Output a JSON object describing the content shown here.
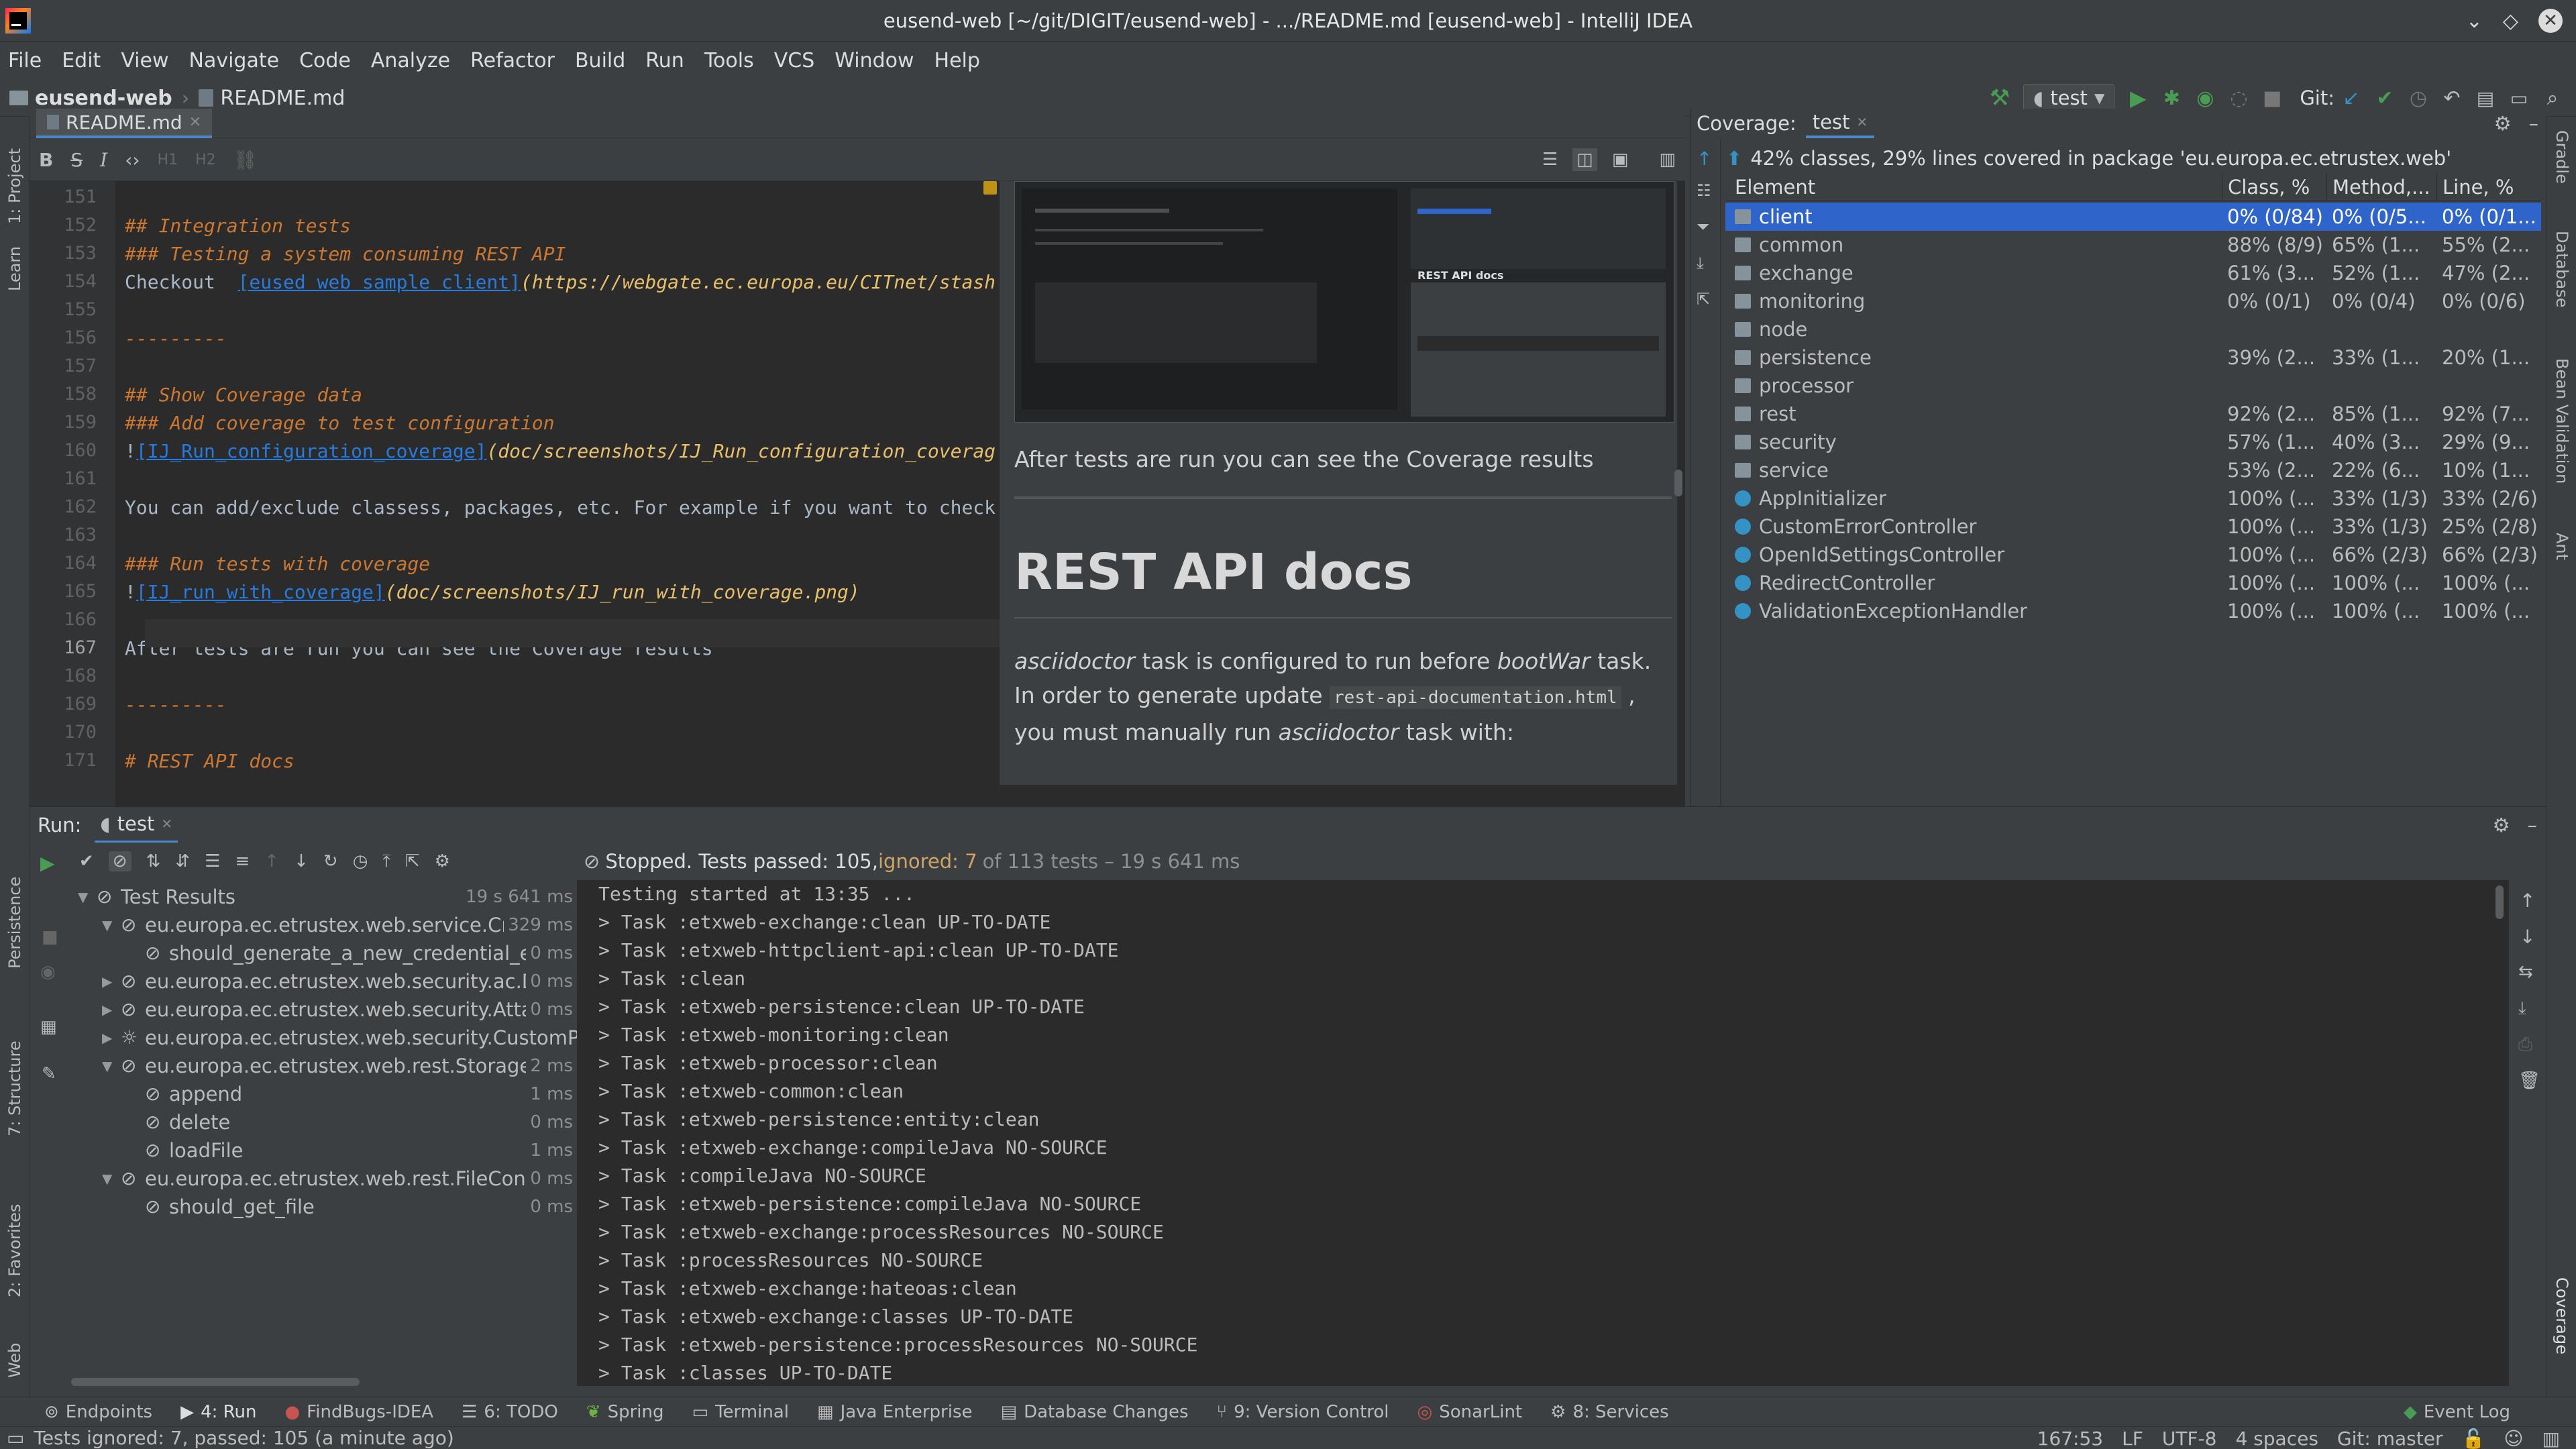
{
  "window": {
    "title": "eusend-web [~/git/DIGIT/eusend-web] - .../README.md [eusend-web] - IntelliJ IDEA"
  },
  "menu": [
    "File",
    "Edit",
    "View",
    "Navigate",
    "Code",
    "Analyze",
    "Refactor",
    "Build",
    "Run",
    "Tools",
    "VCS",
    "Window",
    "Help"
  ],
  "nav": {
    "project": "eusend-web",
    "file": "README.md",
    "run_config": "test",
    "git_label": "Git:"
  },
  "left_tools": [
    "1: Project",
    "Learn"
  ],
  "editor": {
    "tab": "README.md",
    "lines": [
      {
        "n": "151",
        "t": ""
      },
      {
        "n": "152",
        "t": "## Integration tests",
        "k": "h"
      },
      {
        "n": "153",
        "t": "### Testing a system consuming REST API",
        "k": "h"
      },
      {
        "n": "154",
        "pre": "Checkout  ",
        "link": "[eused web sample client]",
        "url": "(https://webgate.ec.europa.eu/CITnet/stash"
      },
      {
        "n": "155",
        "t": ""
      },
      {
        "n": "156",
        "t": "---------",
        "k": "h"
      },
      {
        "n": "157",
        "t": ""
      },
      {
        "n": "158",
        "t": "## Show Coverage data",
        "k": "h"
      },
      {
        "n": "159",
        "t": "### Add coverage to test configuration",
        "k": "h"
      },
      {
        "n": "160",
        "pre": "!",
        "link": "[IJ_Run_configuration_coverage]",
        "url": "(doc/screenshots/IJ_Run_configuration_coverag"
      },
      {
        "n": "161",
        "t": ""
      },
      {
        "n": "162",
        "t": "You can add/exclude classess, packages, etc. For example if you want to check"
      },
      {
        "n": "163",
        "t": ""
      },
      {
        "n": "164",
        "t": "### Run tests with coverage",
        "k": "h"
      },
      {
        "n": "165",
        "pre": "!",
        "link": "[IJ_run_with_coverage]",
        "url": "(doc/screenshots/IJ_run_with_coverage.png)"
      },
      {
        "n": "166",
        "t": ""
      },
      {
        "n": "167",
        "t": "After tests are run you can see the Coverage results"
      },
      {
        "n": "168",
        "t": ""
      },
      {
        "n": "169",
        "t": "---------",
        "k": "h"
      },
      {
        "n": "170",
        "t": ""
      },
      {
        "n": "171",
        "t": "# REST API docs",
        "k": "h"
      }
    ]
  },
  "preview": {
    "caption": "After tests are run you can see the Coverage results",
    "heading": "REST API docs",
    "para_em1": "asciidoctor",
    "para_t1": " task is configured to run before ",
    "para_em2": "bootWar",
    "para_t2": " task.",
    "para_t3": "In order to generate update ",
    "para_code": "rest-api-documentation.html",
    "para_t4": " ,",
    "para_t5": "you must manually run ",
    "para_em3": "asciidoctor",
    "para_t6": " task with:",
    "thumb_title": "REST API docs"
  },
  "coverage": {
    "label": "Coverage:",
    "tab": "test",
    "summary": "42% classes, 29% lines covered in package 'eu.europa.ec.etrustex.web'",
    "columns": [
      "Element",
      "Class, %",
      "Method,...",
      "Line, %"
    ],
    "rows": [
      {
        "name": "client",
        "kind": "pkg",
        "c": "0% (0/84)",
        "m": "0% (0/5...",
        "l": "0% (0/1..."
      },
      {
        "name": "common",
        "kind": "pkg",
        "c": "88% (8/9)",
        "m": "65% (1...",
        "l": "55% (2..."
      },
      {
        "name": "exchange",
        "kind": "pkg",
        "c": "61% (3...",
        "m": "52% (1...",
        "l": "47% (2..."
      },
      {
        "name": "monitoring",
        "kind": "pkg",
        "c": "0% (0/1)",
        "m": "0% (0/4)",
        "l": "0% (0/6)"
      },
      {
        "name": "node",
        "kind": "pkg",
        "c": "",
        "m": "",
        "l": ""
      },
      {
        "name": "persistence",
        "kind": "pkg",
        "c": "39% (2...",
        "m": "33% (1...",
        "l": "20% (1..."
      },
      {
        "name": "processor",
        "kind": "pkg",
        "c": "",
        "m": "",
        "l": ""
      },
      {
        "name": "rest",
        "kind": "pkg",
        "c": "92% (2...",
        "m": "85% (1...",
        "l": "92% (7..."
      },
      {
        "name": "security",
        "kind": "pkg",
        "c": "57% (1...",
        "m": "40% (3...",
        "l": "29% (9..."
      },
      {
        "name": "service",
        "kind": "pkg",
        "c": "53% (2...",
        "m": "22% (6...",
        "l": "10% (1..."
      },
      {
        "name": "AppInitializer",
        "kind": "cls",
        "c": "100% (...",
        "m": "33% (1/3)",
        "l": "33% (2/6)"
      },
      {
        "name": "CustomErrorController",
        "kind": "cls",
        "c": "100% (...",
        "m": "33% (1/3)",
        "l": "25% (2/8)"
      },
      {
        "name": "OpenIdSettingsController",
        "kind": "cls",
        "c": "100% (...",
        "m": "66% (2/3)",
        "l": "66% (2/3)"
      },
      {
        "name": "RedirectController",
        "kind": "cls",
        "c": "100% (...",
        "m": "100% (...",
        "l": "100% (..."
      },
      {
        "name": "ValidationExceptionHandler",
        "kind": "cls",
        "c": "100% (...",
        "m": "100% (...",
        "l": "100% (..."
      }
    ]
  },
  "run": {
    "label": "Run:",
    "tab": "test",
    "status_main": "Stopped. Tests passed: 105, ",
    "status_ignored": "ignored: 7",
    "status_rest": " of 113 tests – 19 s 641 ms",
    "tree": [
      {
        "d": 0,
        "arrow": "▼",
        "label": "Test Results",
        "time": "19 s 641 ms"
      },
      {
        "d": 1,
        "arrow": "▼",
        "label": "eu.europa.ec.etrustex.web.service.Cr",
        "time": "329 ms"
      },
      {
        "d": 2,
        "arrow": "",
        "label": "should_generate_a_new_credential_e",
        "time": "0 ms"
      },
      {
        "d": 1,
        "arrow": "▶",
        "label": "eu.europa.ec.etrustex.web.security.ac.D",
        "time": "0 ms"
      },
      {
        "d": 1,
        "arrow": "▶",
        "label": "eu.europa.ec.etrustex.web.security.Atta",
        "time": "0 ms"
      },
      {
        "d": 1,
        "arrow": "▶",
        "label": "eu.europa.ec.etrustex.web.security.CustomP",
        "time": "",
        "ign": true
      },
      {
        "d": 1,
        "arrow": "▼",
        "label": "eu.europa.ec.etrustex.web.rest.Storage",
        "time": "2 ms"
      },
      {
        "d": 2,
        "arrow": "",
        "label": "append",
        "time": "1 ms"
      },
      {
        "d": 2,
        "arrow": "",
        "label": "delete",
        "time": "0 ms"
      },
      {
        "d": 2,
        "arrow": "",
        "label": "loadFile",
        "time": "1 ms"
      },
      {
        "d": 1,
        "arrow": "▼",
        "label": "eu.europa.ec.etrustex.web.rest.FileCont",
        "time": "0 ms"
      },
      {
        "d": 2,
        "arrow": "",
        "label": "should_get_file",
        "time": "0 ms"
      }
    ],
    "console": [
      "Testing started at 13:35 ...",
      "> Task :etxweb-exchange:clean UP-TO-DATE",
      "> Task :etxweb-httpclient-api:clean UP-TO-DATE",
      "> Task :clean",
      "> Task :etxweb-persistence:clean UP-TO-DATE",
      "> Task :etxweb-monitoring:clean",
      "> Task :etxweb-processor:clean",
      "> Task :etxweb-common:clean",
      "> Task :etxweb-persistence:entity:clean",
      "> Task :etxweb-exchange:compileJava NO-SOURCE",
      "> Task :compileJava NO-SOURCE",
      "> Task :etxweb-persistence:compileJava NO-SOURCE",
      "> Task :etxweb-exchange:processResources NO-SOURCE",
      "> Task :processResources NO-SOURCE",
      "> Task :etxweb-exchange:hateoas:clean",
      "> Task :etxweb-exchange:classes UP-TO-DATE",
      "> Task :etxweb-persistence:processResources NO-SOURCE",
      "> Task :classes UP-TO-DATE"
    ]
  },
  "left_run_tools": [
    "Persistence",
    "7: Structure",
    "2: Favorites",
    "Web"
  ],
  "right_tools": [
    "Gradle",
    "Database",
    "Bean Validation",
    "Ant",
    "Coverage"
  ],
  "bottom_tabs": [
    {
      "id": "endpoints",
      "label": "Endpoints"
    },
    {
      "id": "run",
      "label": "4: Run"
    },
    {
      "id": "findbugs",
      "label": "FindBugs-IDEA"
    },
    {
      "id": "todo",
      "label": "6: TODO"
    },
    {
      "id": "spring",
      "label": "Spring"
    },
    {
      "id": "terminal",
      "label": "Terminal"
    },
    {
      "id": "javaee",
      "label": "Java Enterprise"
    },
    {
      "id": "dbchanges",
      "label": "Database Changes"
    },
    {
      "id": "vcs",
      "label": "9: Version Control"
    },
    {
      "id": "sonarlint",
      "label": "SonarLint"
    },
    {
      "id": "services",
      "label": "8: Services"
    }
  ],
  "event_log": "Event Log",
  "status": {
    "message": "Tests ignored: 7, passed: 105 (a minute ago)",
    "position": "167:53",
    "line_sep": "LF",
    "encoding": "UTF-8",
    "indent": "4 spaces",
    "git": "Git: master"
  },
  "colors": {
    "selection": "#2f65ca",
    "accent_green": "#499c54",
    "ignored": "#d0a465",
    "link": "#287bde"
  }
}
